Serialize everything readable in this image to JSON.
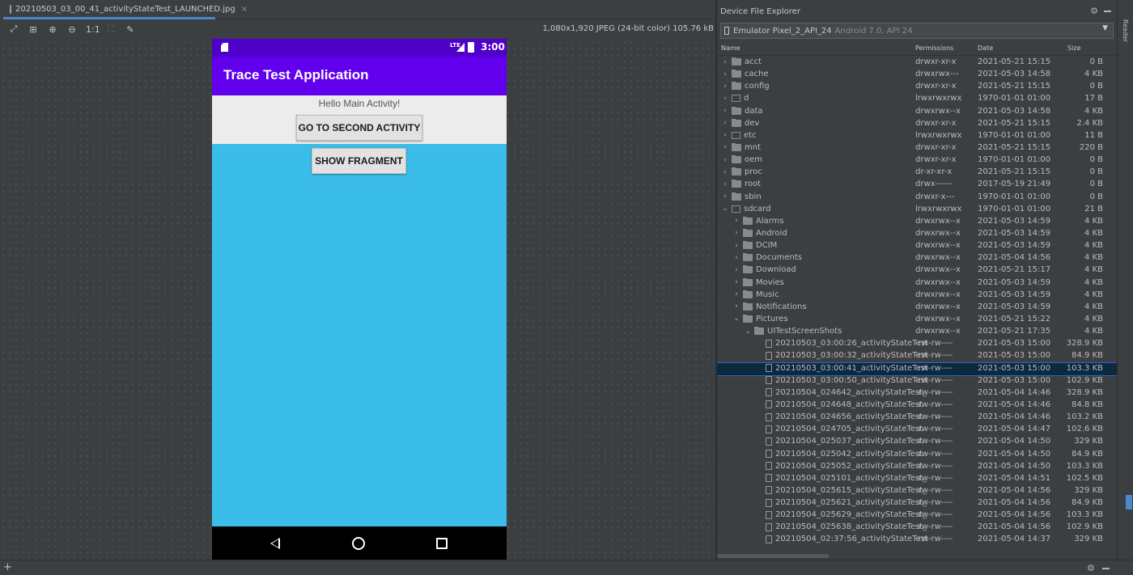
{
  "editor": {
    "tab_label": "20210503_03_00_41_activityStateTest_LAUNCHED.jpg",
    "tab_close": "×",
    "image_info": "1,080x1,920 JPEG (24-bit color) 105.76 kB",
    "toolbar": {
      "zoom_actual": "1:1"
    }
  },
  "phone": {
    "status_time": "3:00",
    "status_network": "LTE",
    "app_title": "Trace Test Application",
    "hello_text": "Hello Main Activity!",
    "second_activity_button": "GO TO SECOND ACTIVITY",
    "show_fragment_button": "SHOW FRAGMENT",
    "colors": {
      "status_bar": "#4f00c9",
      "app_bar": "#6200ee",
      "main_bg": "#ececec",
      "fragment_bg": "#3abde9",
      "nav_bar": "#000000"
    }
  },
  "explorer": {
    "title": "Device File Explorer",
    "device": "Emulator Pixel_2_API_24",
    "device_sub": "Android 7.0, API 24",
    "columns": {
      "name": "Name",
      "permissions": "Permissions",
      "date": "Date",
      "size": "Size"
    },
    "rows": [
      {
        "indent": 0,
        "type": "folder",
        "expanded": false,
        "name": "acct",
        "perm": "drwxr-xr-x",
        "date": "2021-05-21 15:15",
        "size": "0 B"
      },
      {
        "indent": 0,
        "type": "folder",
        "expanded": false,
        "name": "cache",
        "perm": "drwxrwx---",
        "date": "2021-05-03 14:58",
        "size": "4 KB"
      },
      {
        "indent": 0,
        "type": "folder",
        "expanded": false,
        "name": "config",
        "perm": "drwxr-xr-x",
        "date": "2021-05-21 15:15",
        "size": "0 B"
      },
      {
        "indent": 0,
        "type": "link",
        "expanded": false,
        "name": "d",
        "perm": "lrwxrwxrwx",
        "date": "1970-01-01 01:00",
        "size": "17 B"
      },
      {
        "indent": 0,
        "type": "folder",
        "expanded": false,
        "name": "data",
        "perm": "drwxrwx--x",
        "date": "2021-05-03 14:58",
        "size": "4 KB"
      },
      {
        "indent": 0,
        "type": "folder",
        "expanded": false,
        "name": "dev",
        "perm": "drwxr-xr-x",
        "date": "2021-05-21 15:15",
        "size": "2.4 KB"
      },
      {
        "indent": 0,
        "type": "link",
        "expanded": false,
        "name": "etc",
        "perm": "lrwxrwxrwx",
        "date": "1970-01-01 01:00",
        "size": "11 B"
      },
      {
        "indent": 0,
        "type": "folder",
        "expanded": false,
        "name": "mnt",
        "perm": "drwxr-xr-x",
        "date": "2021-05-21 15:15",
        "size": "220 B"
      },
      {
        "indent": 0,
        "type": "folder",
        "expanded": false,
        "name": "oem",
        "perm": "drwxr-xr-x",
        "date": "1970-01-01 01:00",
        "size": "0 B"
      },
      {
        "indent": 0,
        "type": "folder",
        "expanded": false,
        "name": "proc",
        "perm": "dr-xr-xr-x",
        "date": "2021-05-21 15:15",
        "size": "0 B"
      },
      {
        "indent": 0,
        "type": "folder",
        "expanded": false,
        "name": "root",
        "perm": "drwx------",
        "date": "2017-05-19 21:49",
        "size": "0 B"
      },
      {
        "indent": 0,
        "type": "folder",
        "expanded": false,
        "name": "sbin",
        "perm": "drwxr-x---",
        "date": "1970-01-01 01:00",
        "size": "0 B"
      },
      {
        "indent": 0,
        "type": "link",
        "expanded": true,
        "name": "sdcard",
        "perm": "lrwxrwxrwx",
        "date": "1970-01-01 01:00",
        "size": "21 B"
      },
      {
        "indent": 1,
        "type": "folder",
        "expanded": false,
        "name": "Alarms",
        "perm": "drwxrwx--x",
        "date": "2021-05-03 14:59",
        "size": "4 KB"
      },
      {
        "indent": 1,
        "type": "folder",
        "expanded": false,
        "name": "Android",
        "perm": "drwxrwx--x",
        "date": "2021-05-03 14:59",
        "size": "4 KB"
      },
      {
        "indent": 1,
        "type": "folder",
        "expanded": false,
        "name": "DCIM",
        "perm": "drwxrwx--x",
        "date": "2021-05-03 14:59",
        "size": "4 KB"
      },
      {
        "indent": 1,
        "type": "folder",
        "expanded": false,
        "name": "Documents",
        "perm": "drwxrwx--x",
        "date": "2021-05-04 14:56",
        "size": "4 KB"
      },
      {
        "indent": 1,
        "type": "folder",
        "expanded": false,
        "name": "Download",
        "perm": "drwxrwx--x",
        "date": "2021-05-21 15:17",
        "size": "4 KB"
      },
      {
        "indent": 1,
        "type": "folder",
        "expanded": false,
        "name": "Movies",
        "perm": "drwxrwx--x",
        "date": "2021-05-03 14:59",
        "size": "4 KB"
      },
      {
        "indent": 1,
        "type": "folder",
        "expanded": false,
        "name": "Music",
        "perm": "drwxrwx--x",
        "date": "2021-05-03 14:59",
        "size": "4 KB"
      },
      {
        "indent": 1,
        "type": "folder",
        "expanded": false,
        "name": "Notifications",
        "perm": "drwxrwx--x",
        "date": "2021-05-03 14:59",
        "size": "4 KB"
      },
      {
        "indent": 1,
        "type": "folder",
        "expanded": true,
        "name": "Pictures",
        "perm": "drwxrwx--x",
        "date": "2021-05-21 15:22",
        "size": "4 KB"
      },
      {
        "indent": 2,
        "type": "folder",
        "expanded": true,
        "name": "UITestScreenShots",
        "perm": "drwxrwx--x",
        "date": "2021-05-21 17:35",
        "size": "4 KB"
      },
      {
        "indent": 3,
        "type": "file",
        "name": "20210503_03:00:26_activityStateTest",
        "perm": "-rw-rw----",
        "date": "2021-05-03 15:00",
        "size": "328.9 KB"
      },
      {
        "indent": 3,
        "type": "file",
        "name": "20210503_03:00:32_activityStateTest",
        "perm": "-rw-rw----",
        "date": "2021-05-03 15:00",
        "size": "84.9 KB"
      },
      {
        "indent": 3,
        "type": "file",
        "selected": true,
        "name": "20210503_03:00:41_activityStateTest",
        "perm": "-rw-rw----",
        "date": "2021-05-03 15:00",
        "size": "103.3 KB"
      },
      {
        "indent": 3,
        "type": "file",
        "name": "20210503_03:00:50_activityStateTest",
        "perm": "-rw-rw----",
        "date": "2021-05-03 15:00",
        "size": "102.9 KB"
      },
      {
        "indent": 3,
        "type": "file",
        "name": "20210504_024642_activityStateTest_",
        "perm": "-rw-rw----",
        "date": "2021-05-04 14:46",
        "size": "328.9 KB"
      },
      {
        "indent": 3,
        "type": "file",
        "name": "20210504_024648_activityStateTest",
        "perm": "-rw-rw----",
        "date": "2021-05-04 14:46",
        "size": "84.8 KB"
      },
      {
        "indent": 3,
        "type": "file",
        "name": "20210504_024656_activityStateTest",
        "perm": "-rw-rw----",
        "date": "2021-05-04 14:46",
        "size": "103.2 KB"
      },
      {
        "indent": 3,
        "type": "file",
        "name": "20210504_024705_activityStateTest",
        "perm": "-rw-rw----",
        "date": "2021-05-04 14:47",
        "size": "102.6 KB"
      },
      {
        "indent": 3,
        "type": "file",
        "name": "20210504_025037_activityStateTest",
        "perm": "-rw-rw----",
        "date": "2021-05-04 14:50",
        "size": "329 KB"
      },
      {
        "indent": 3,
        "type": "file",
        "name": "20210504_025042_activityStateTest",
        "perm": "-rw-rw----",
        "date": "2021-05-04 14:50",
        "size": "84.9 KB"
      },
      {
        "indent": 3,
        "type": "file",
        "name": "20210504_025052_activityStateTest",
        "perm": "-rw-rw----",
        "date": "2021-05-04 14:50",
        "size": "103.3 KB"
      },
      {
        "indent": 3,
        "type": "file",
        "name": "20210504_025101_activityStateTest_",
        "perm": "-rw-rw----",
        "date": "2021-05-04 14:51",
        "size": "102.5 KB"
      },
      {
        "indent": 3,
        "type": "file",
        "name": "20210504_025615_activityStateTest_",
        "perm": "-rw-rw----",
        "date": "2021-05-04 14:56",
        "size": "329 KB"
      },
      {
        "indent": 3,
        "type": "file",
        "name": "20210504_025621_activityStateTest_",
        "perm": "-rw-rw----",
        "date": "2021-05-04 14:56",
        "size": "84.9 KB"
      },
      {
        "indent": 3,
        "type": "file",
        "name": "20210504_025629_activityStateTest_",
        "perm": "-rw-rw----",
        "date": "2021-05-04 14:56",
        "size": "103.3 KB"
      },
      {
        "indent": 3,
        "type": "file",
        "name": "20210504_025638_activityStateTest_",
        "perm": "-rw-rw----",
        "date": "2021-05-04 14:56",
        "size": "102.9 KB"
      },
      {
        "indent": 3,
        "type": "file",
        "name": "20210504_02:37:56_activityStateTest",
        "perm": "-rw-rw----",
        "date": "2021-05-04 14:37",
        "size": "329 KB"
      }
    ]
  },
  "side_strip": {
    "label": "Reader"
  }
}
